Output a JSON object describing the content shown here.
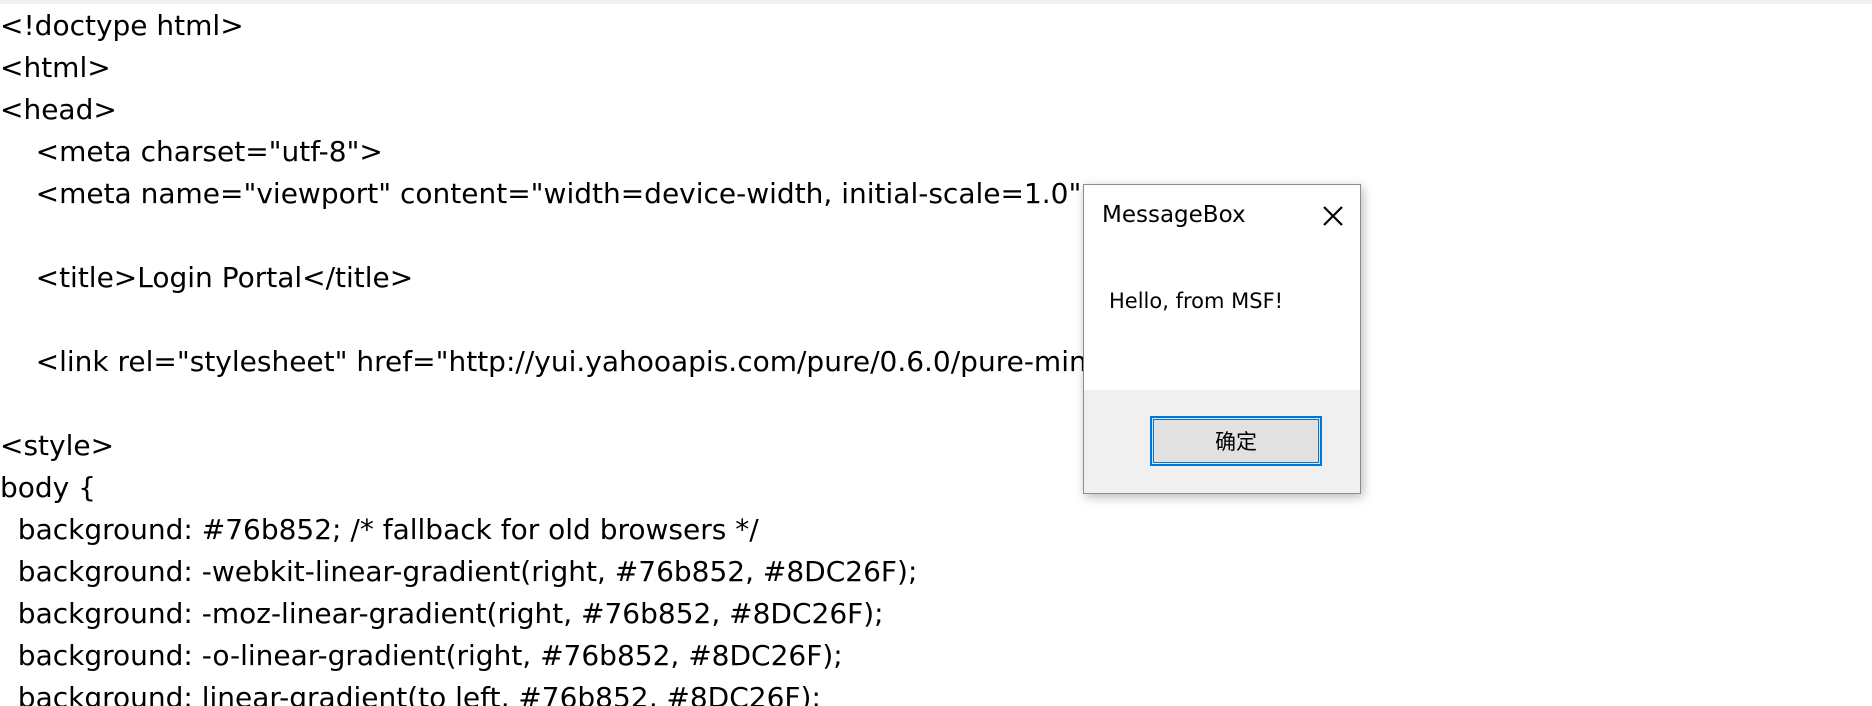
{
  "editor": {
    "lines": [
      "<!doctype html>",
      "<html>",
      "<head>",
      "    <meta charset=\"utf-8\">",
      "    <meta name=\"viewport\" content=\"width=device-width, initial-scale=1.0\">",
      "",
      "    <title>Login Portal</title>",
      "",
      "    <link rel=\"stylesheet\" href=\"http://yui.yahooapis.com/pure/0.6.0/pure-min.css\">",
      "",
      "<style>",
      "body {",
      "  background: #76b852; /* fallback for old browsers */",
      "  background: -webkit-linear-gradient(right, #76b852, #8DC26F);",
      "  background: -moz-linear-gradient(right, #76b852, #8DC26F);",
      "  background: -o-linear-gradient(right, #76b852, #8DC26F);",
      "  background: linear-gradient(to left, #76b852, #8DC26F);"
    ]
  },
  "messagebox": {
    "title": "MessageBox",
    "message": "Hello, from MSF!",
    "ok_label": "确定",
    "close_icon": "close-icon"
  }
}
